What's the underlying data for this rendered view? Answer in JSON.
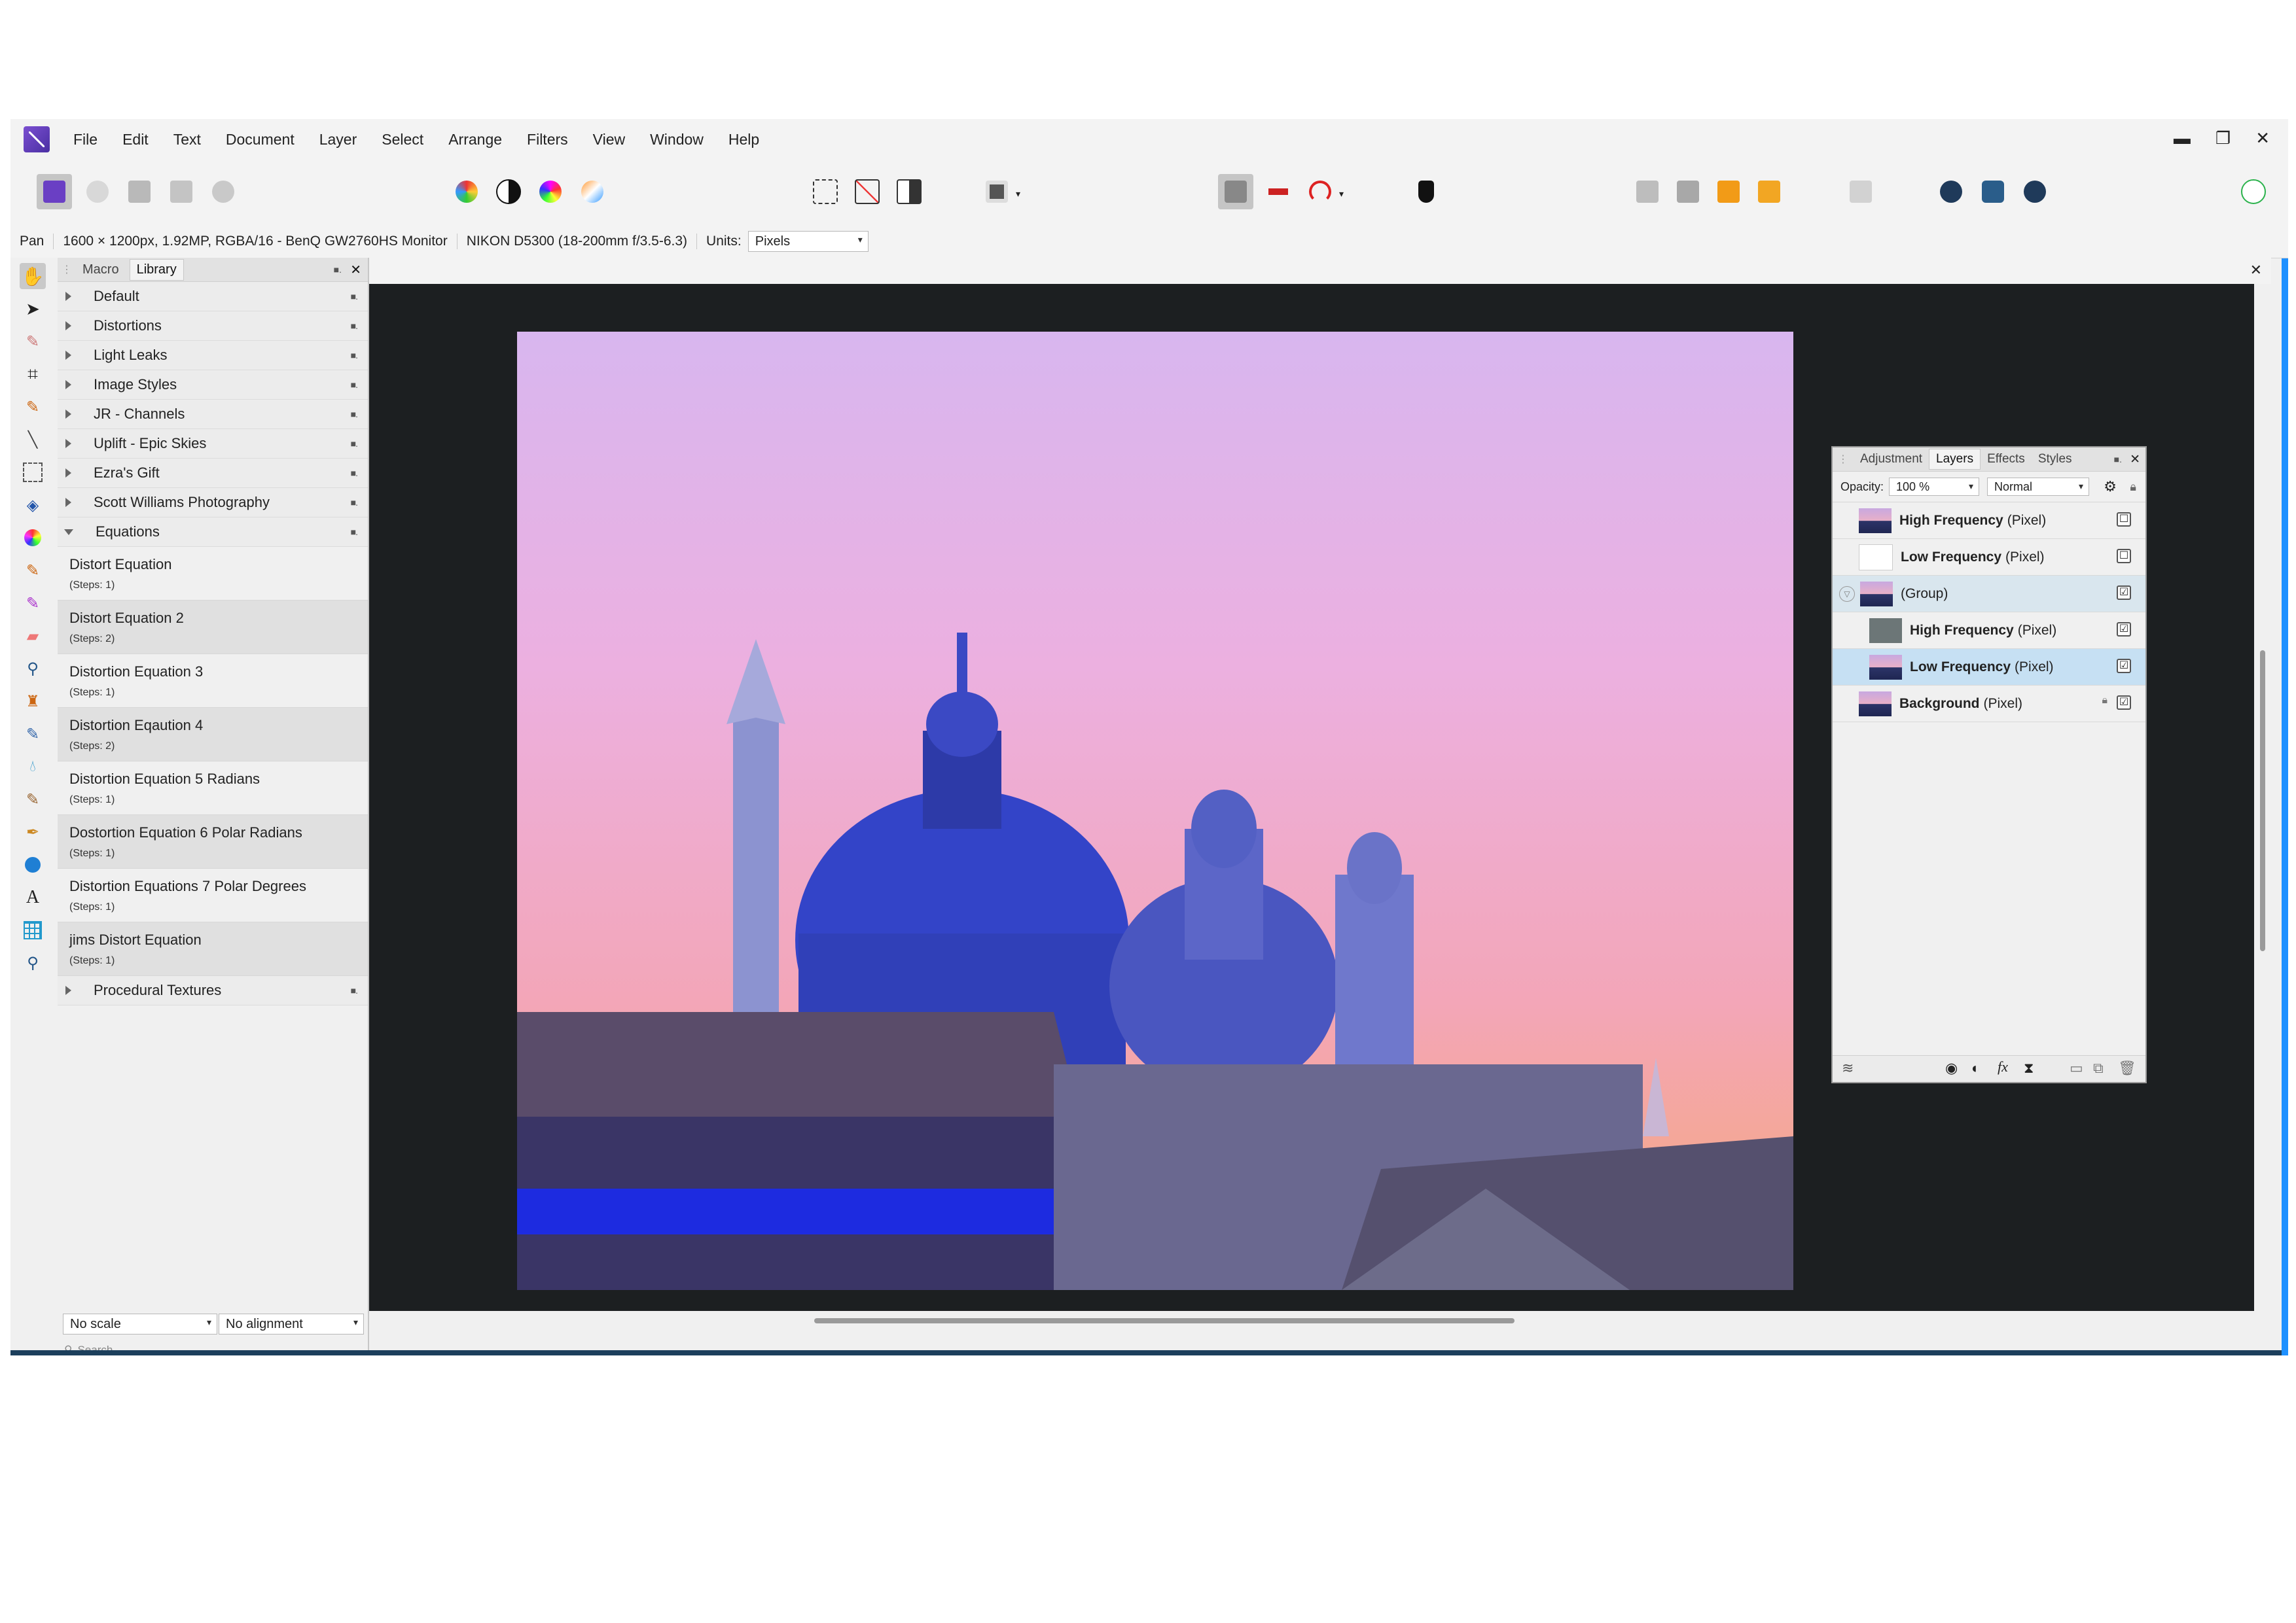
{
  "menu": [
    "File",
    "Edit",
    "Text",
    "Document",
    "Layer",
    "Select",
    "Arrange",
    "Filters",
    "View",
    "Window",
    "Help"
  ],
  "window_controls": {
    "minimize": "▬",
    "restore": "❐",
    "close": "✕"
  },
  "context": {
    "tool": "Pan",
    "doc_info": "1600 × 1200px, 1.92MP, RGBA/16 - BenQ GW2760HS Monitor",
    "camera": "NIKON D5300 (18-200mm f/3.5-6.3)",
    "units_label": "Units:",
    "units_value": "Pixels"
  },
  "library": {
    "tabs": [
      "Macro",
      "Library"
    ],
    "categories_top": [
      "Default",
      "Distortions",
      "Light Leaks",
      "Image Styles",
      "JR - Channels",
      "Uplift - Epic Skies",
      "Ezra's Gift",
      "Scott Williams Photography"
    ],
    "open_category": "Equations",
    "macros": [
      {
        "name": "Distort Equation",
        "steps": "(Steps: 1)"
      },
      {
        "name": "Distort Equation 2",
        "steps": "(Steps: 2)"
      },
      {
        "name": "Distortion Equation 3",
        "steps": "(Steps: 1)"
      },
      {
        "name": "Distortion Eqaution 4",
        "steps": "(Steps: 2)"
      },
      {
        "name": "Distortion Equation 5 Radians",
        "steps": "(Steps: 1)"
      },
      {
        "name": "Dostortion Equation 6 Polar Radians",
        "steps": "(Steps: 1)"
      },
      {
        "name": "Distortion Equations 7 Polar Degrees",
        "steps": "(Steps: 1)"
      },
      {
        "name": "jims Distort Equation",
        "steps": "(Steps: 1)"
      }
    ],
    "category_bottom": "Procedural Textures",
    "scale_select": "No scale",
    "align_select": "No alignment",
    "search_placeholder": "Search"
  },
  "layers_panel": {
    "tabs": [
      "Adjustment",
      "Layers",
      "Effects",
      "Styles"
    ],
    "opacity_label": "Opacity:",
    "opacity_value": "100 %",
    "blend_mode": "Normal",
    "layers": [
      {
        "name": "High Frequency",
        "type": "(Pixel)",
        "checked": "☐"
      },
      {
        "name": "Low Frequency",
        "type": "(Pixel)",
        "checked": "☐"
      },
      {
        "name": "",
        "type": "(Group)",
        "checked": "☑"
      },
      {
        "name": "High Frequency",
        "type": "(Pixel)",
        "checked": "☑"
      },
      {
        "name": "Low Frequency",
        "type": "(Pixel)",
        "checked": "☑"
      },
      {
        "name": "Background",
        "type": "(Pixel)",
        "checked": "☑"
      }
    ]
  },
  "colors": {
    "accent": "#1e90ff",
    "selection": "#c6e0f3",
    "canvas_bg": "#1c1f21"
  }
}
